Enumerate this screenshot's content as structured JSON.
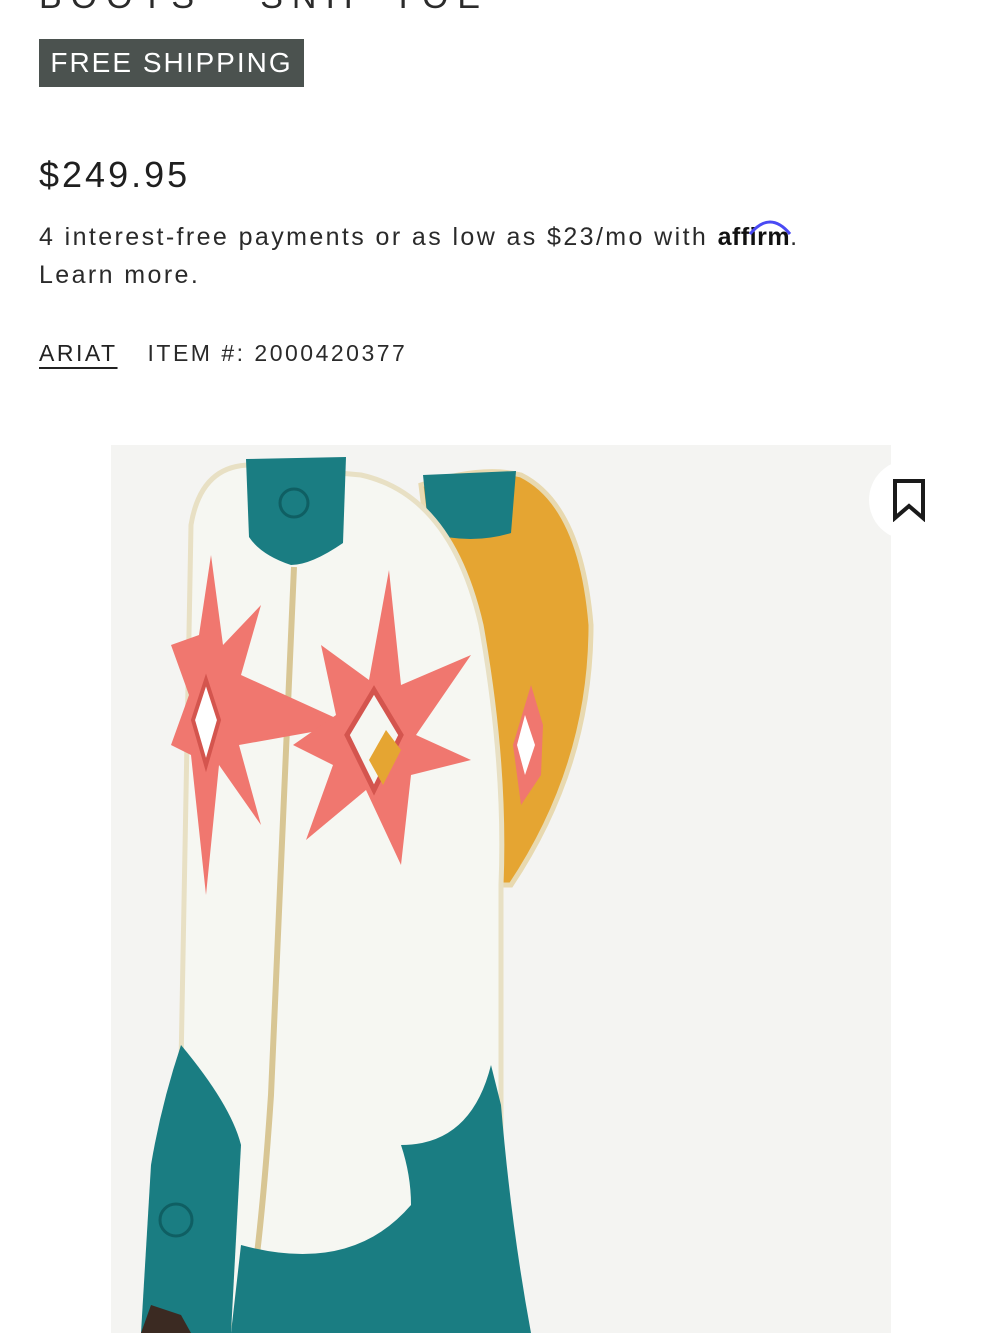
{
  "product": {
    "title_partial": "BOOTS - SNIP TOE",
    "shipping_badge": "FREE SHIPPING",
    "price": "$249.95",
    "installment_text": "4 interest-free payments or as low as $23/mo with",
    "affirm_logo": "affirm",
    "installment_period": ".",
    "learn_more": "Learn more.",
    "brand": "ARIAT",
    "item_number": "ITEM #: 2000420377"
  },
  "image": {
    "bookmark_icon": "bookmark-icon",
    "colors": {
      "shaft": "#f6f7f2",
      "star": "#f0776f",
      "teal": "#1a7d82",
      "lining": "#e5a532",
      "badge_bg": "#4b524f"
    }
  }
}
